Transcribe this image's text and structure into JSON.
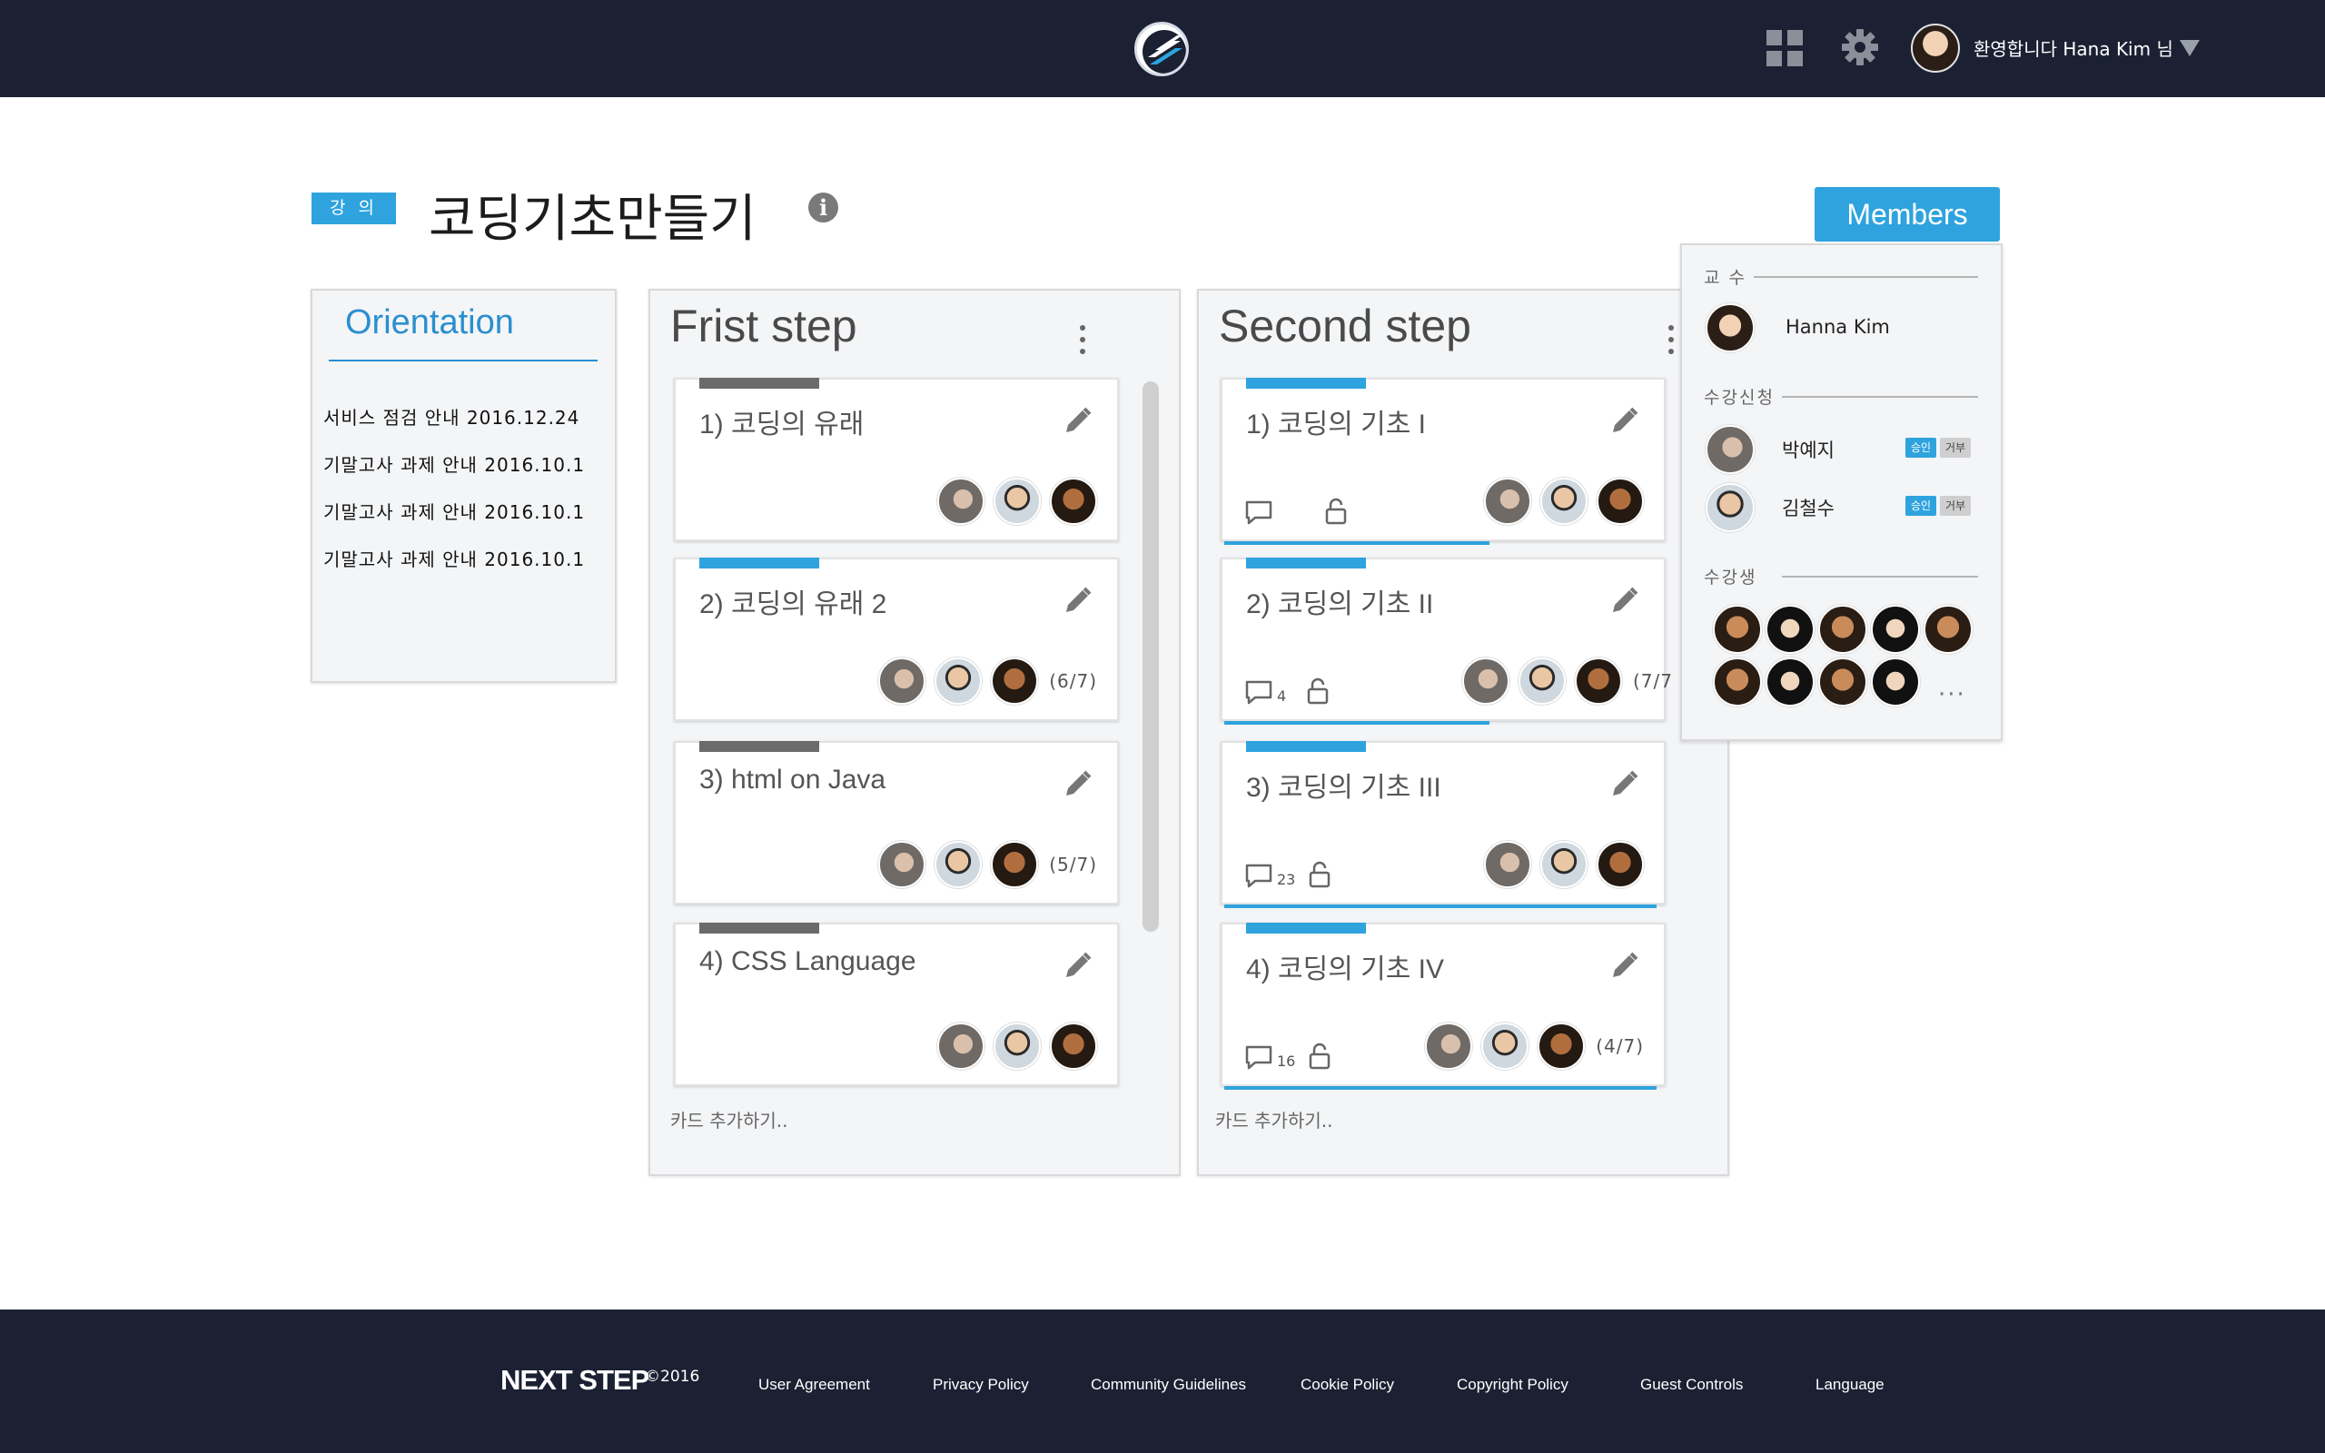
{
  "header": {
    "logo_icon": "nextstep-logo-icon",
    "welcome": "환영합니다 Hana Kim 님",
    "apps_icon": "grid-icon",
    "settings_icon": "gear-icon",
    "menu_icon": "caret-down-icon"
  },
  "course": {
    "badge": "강 의",
    "title": "코딩기초만들기",
    "info_icon": "i",
    "members_button": "Members"
  },
  "orientation": {
    "title": "Orientation",
    "notices": [
      "서비스 점검 안내  2016.12.24",
      "기말고사 과제 안내 2016.10.1",
      "기말고사 과제 안내 2016.10.1",
      "기말고사 과제 안내 2016.10.1"
    ]
  },
  "lists": [
    {
      "title": "Frist step",
      "add_card": "카드 추가하기..",
      "cards": [
        {
          "title": "1) 코딩의 유래",
          "count": "",
          "comments": "",
          "tag_color": "#6b6b6b"
        },
        {
          "title": "2) 코딩의 유래 2",
          "count": "(6/7)",
          "comments": "",
          "tag_color": "#2ea3de"
        },
        {
          "title": "3) html on Java",
          "count": "(5/7)",
          "comments": "",
          "tag_color": "#6b6b6b"
        },
        {
          "title": "4) CSS Language",
          "count": "",
          "comments": "",
          "tag_color": "#6b6b6b"
        }
      ]
    },
    {
      "title": "Second step",
      "add_card": "카드 추가하기..",
      "cards": [
        {
          "title": "1) 코딩의 기초 I",
          "count": "",
          "comments": "",
          "tag_color": "#2ea3de",
          "progress": 0.6
        },
        {
          "title": "2) 코딩의 기초 II",
          "count": "(7/7",
          "comments": "4",
          "tag_color": "#2ea3de",
          "progress": 0.6
        },
        {
          "title": "3) 코딩의 기초 III",
          "count": "",
          "comments": "23",
          "tag_color": "#2ea3de",
          "progress": 0.98
        },
        {
          "title": "4) 코딩의 기초 IV",
          "count": "(4/7)",
          "comments": "16",
          "tag_color": "#2ea3de",
          "progress": 0.98
        }
      ]
    }
  ],
  "members": {
    "professor_label": "교 수",
    "professor_name": "Hanna Kim",
    "applicants_label": "수강신청",
    "applicants": [
      {
        "name": "박예지",
        "approve": "승인",
        "reject": "거부"
      },
      {
        "name": "김철수",
        "approve": "승인",
        "reject": "거부"
      }
    ],
    "students_label": "수강생",
    "more": "···"
  },
  "footer": {
    "brand": "NEXT STEP",
    "copyright": "©2016",
    "links": [
      "User Agreement",
      "Privacy Policy",
      "Community Guidelines",
      "Cookie Policy",
      "Copyright Policy",
      "Guest Controls",
      "Language"
    ]
  },
  "colors": {
    "header_bg": "#1b2133",
    "accent": "#2ea3de",
    "tag_gray": "#6b6b6b"
  }
}
